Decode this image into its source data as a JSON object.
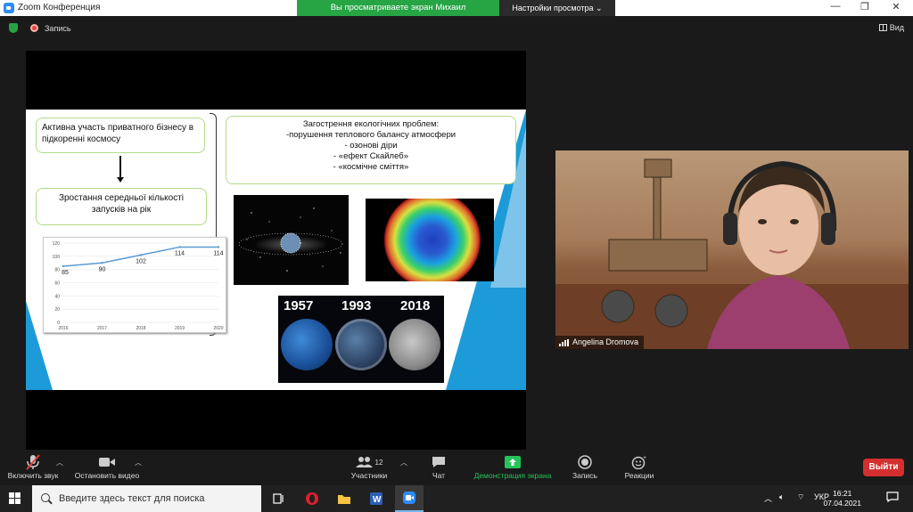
{
  "window": {
    "title": "Zoom Конференция",
    "minimize": "—",
    "maximize": "❐",
    "close": "✕"
  },
  "share": {
    "message": "Вы просматриваете экран Михаил Блощицын",
    "options_label": "Настройки просмотра ⌄"
  },
  "status": {
    "record_label": "Запись",
    "view_label": "Вид"
  },
  "slide": {
    "box1": "Активна участь приватного бізнесу в підкоренні космосу",
    "box2": "Зростання середньої кількості запусків на рік",
    "box3_lines": [
      "Загострення екологічних проблем:",
      "-порушення теплового балансу атмосфери",
      "-   озонові діри",
      "-   «ефект Скайлеб»",
      "-   «космічне сміття»"
    ],
    "timeline_years": [
      "1957",
      "1993",
      "2018"
    ]
  },
  "chart_data": {
    "type": "line",
    "x": [
      "2016",
      "2017",
      "2018",
      "2019",
      "2020"
    ],
    "series": [
      {
        "values": [
          85,
          90,
          102,
          114,
          114
        ]
      }
    ],
    "data_labels": [
      "85",
      "90",
      "102",
      "114",
      "114"
    ],
    "y_ticks": [
      "0",
      "20",
      "40",
      "60",
      "80",
      "100",
      "120"
    ],
    "ylim": [
      0,
      120
    ],
    "color": "#5b9bd5"
  },
  "participant": {
    "name": "Angelina Dromova"
  },
  "toolbar": {
    "mute_label": "Включить звук",
    "video_label": "Остановить видео",
    "participants_label": "Участники",
    "participants_count": "12",
    "chat_label": "Чат",
    "share_label": "Демонстрация экрана",
    "record_label": "Запись",
    "reactions_label": "Реакции",
    "exit_label": "Выйти"
  },
  "taskbar": {
    "search_placeholder": "Введите здесь текст для поиска",
    "language": "УКР",
    "time": "16:21",
    "date": "07.04.2021"
  },
  "colors": {
    "share_green": "#27a545",
    "exit_red": "#d32f2f",
    "slide_blue": "#1c9bd8",
    "box_border": "#b4da86"
  }
}
